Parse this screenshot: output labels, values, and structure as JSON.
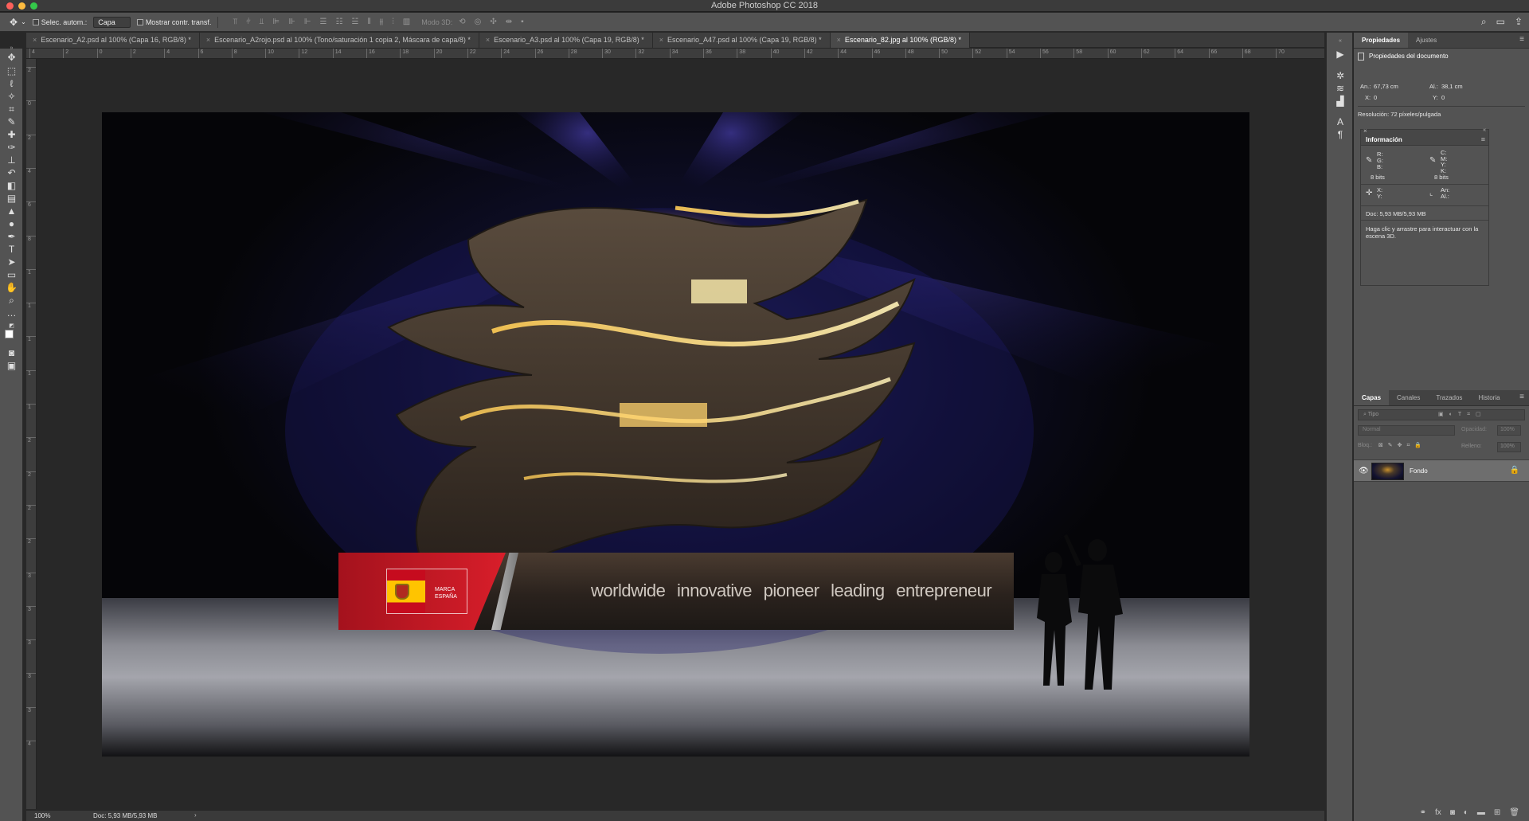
{
  "window": {
    "title": "Adobe Photoshop CC 2018"
  },
  "options": {
    "auto_select_label": "Selec. autom.:",
    "auto_select_value": "Capa",
    "show_transform_label": "Mostrar contr. transf.",
    "mode_3d_label": "Modo 3D:"
  },
  "tabs": [
    {
      "label": "Escenario_A2.psd al 100% (Capa 16, RGB/8) *"
    },
    {
      "label": "Escenario_A2rojo.psd al 100% (Tono/saturación 1 copia 2, Máscara de capa/8) *"
    },
    {
      "label": "Escenario_A3.psd al 100% (Capa 19, RGB/8) *"
    },
    {
      "label": "Escenario_A47.psd al 100% (Capa 19, RGB/8) *"
    },
    {
      "label": "Escenario_82.jpg al 100% (RGB/8) *"
    }
  ],
  "ruler": {
    "h_ticks": [
      "4",
      "2",
      "0",
      "2",
      "4",
      "6",
      "8",
      "10",
      "12",
      "14",
      "16",
      "18",
      "20",
      "22",
      "24",
      "26",
      "28",
      "30",
      "32",
      "34",
      "36",
      "38",
      "40",
      "42",
      "44",
      "46",
      "48",
      "50",
      "52",
      "54",
      "56",
      "58",
      "60",
      "62",
      "64",
      "66",
      "68",
      "70"
    ],
    "v_ticks": [
      "2",
      "0",
      "2",
      "4",
      "6",
      "8",
      "1",
      "1",
      "1",
      "1",
      "1",
      "2",
      "2",
      "2",
      "2",
      "3",
      "3",
      "3",
      "3",
      "3",
      "4"
    ]
  },
  "artwork": {
    "brand_line1": "MARCA",
    "brand_line2": "ESPAÑA",
    "slogan_words": [
      "worldwide",
      "innovative",
      "pioneer",
      "leading",
      "entrepreneur"
    ]
  },
  "status": {
    "zoom": "100%",
    "doc": "Doc: 5,93 MB/5,93 MB",
    "arrow": "›"
  },
  "properties": {
    "tabs": [
      "Propiedades",
      "Ajustes"
    ],
    "header": "Propiedades del documento",
    "width_label": "An.:",
    "width_value": "67,73 cm",
    "height_label": "Al.:",
    "height_value": "38,1 cm",
    "x_label": "X:",
    "x_value": "0",
    "y_label": "Y:",
    "y_value": "0",
    "resolution": "Resolución: 72 píxeles/pulgada"
  },
  "info": {
    "title": "Información",
    "rgb_labels": "R:\nG:\nB:",
    "cmyk_labels": "C:\nM:\nY:\nK:",
    "bits_left": "8 bits",
    "bits_right": "8 bits",
    "xy_labels": "X:\nY:",
    "wh_labels": "An:\nAl.:",
    "doc": "Doc: 5,93 MB/5,93 MB",
    "hint": "Haga clic y arrastre para interactuar con la escena 3D."
  },
  "layers": {
    "tabs": [
      "Capas",
      "Canales",
      "Trazados",
      "Historia"
    ],
    "search_placeholder": "Tipo",
    "blend_mode": "Normal",
    "opacity_label": "Opacidad:",
    "opacity_value": "100%",
    "lock_label": "Bloq.:",
    "fill_label": "Relleno:",
    "fill_value": "100%",
    "items": [
      {
        "name": "Fondo"
      }
    ]
  }
}
